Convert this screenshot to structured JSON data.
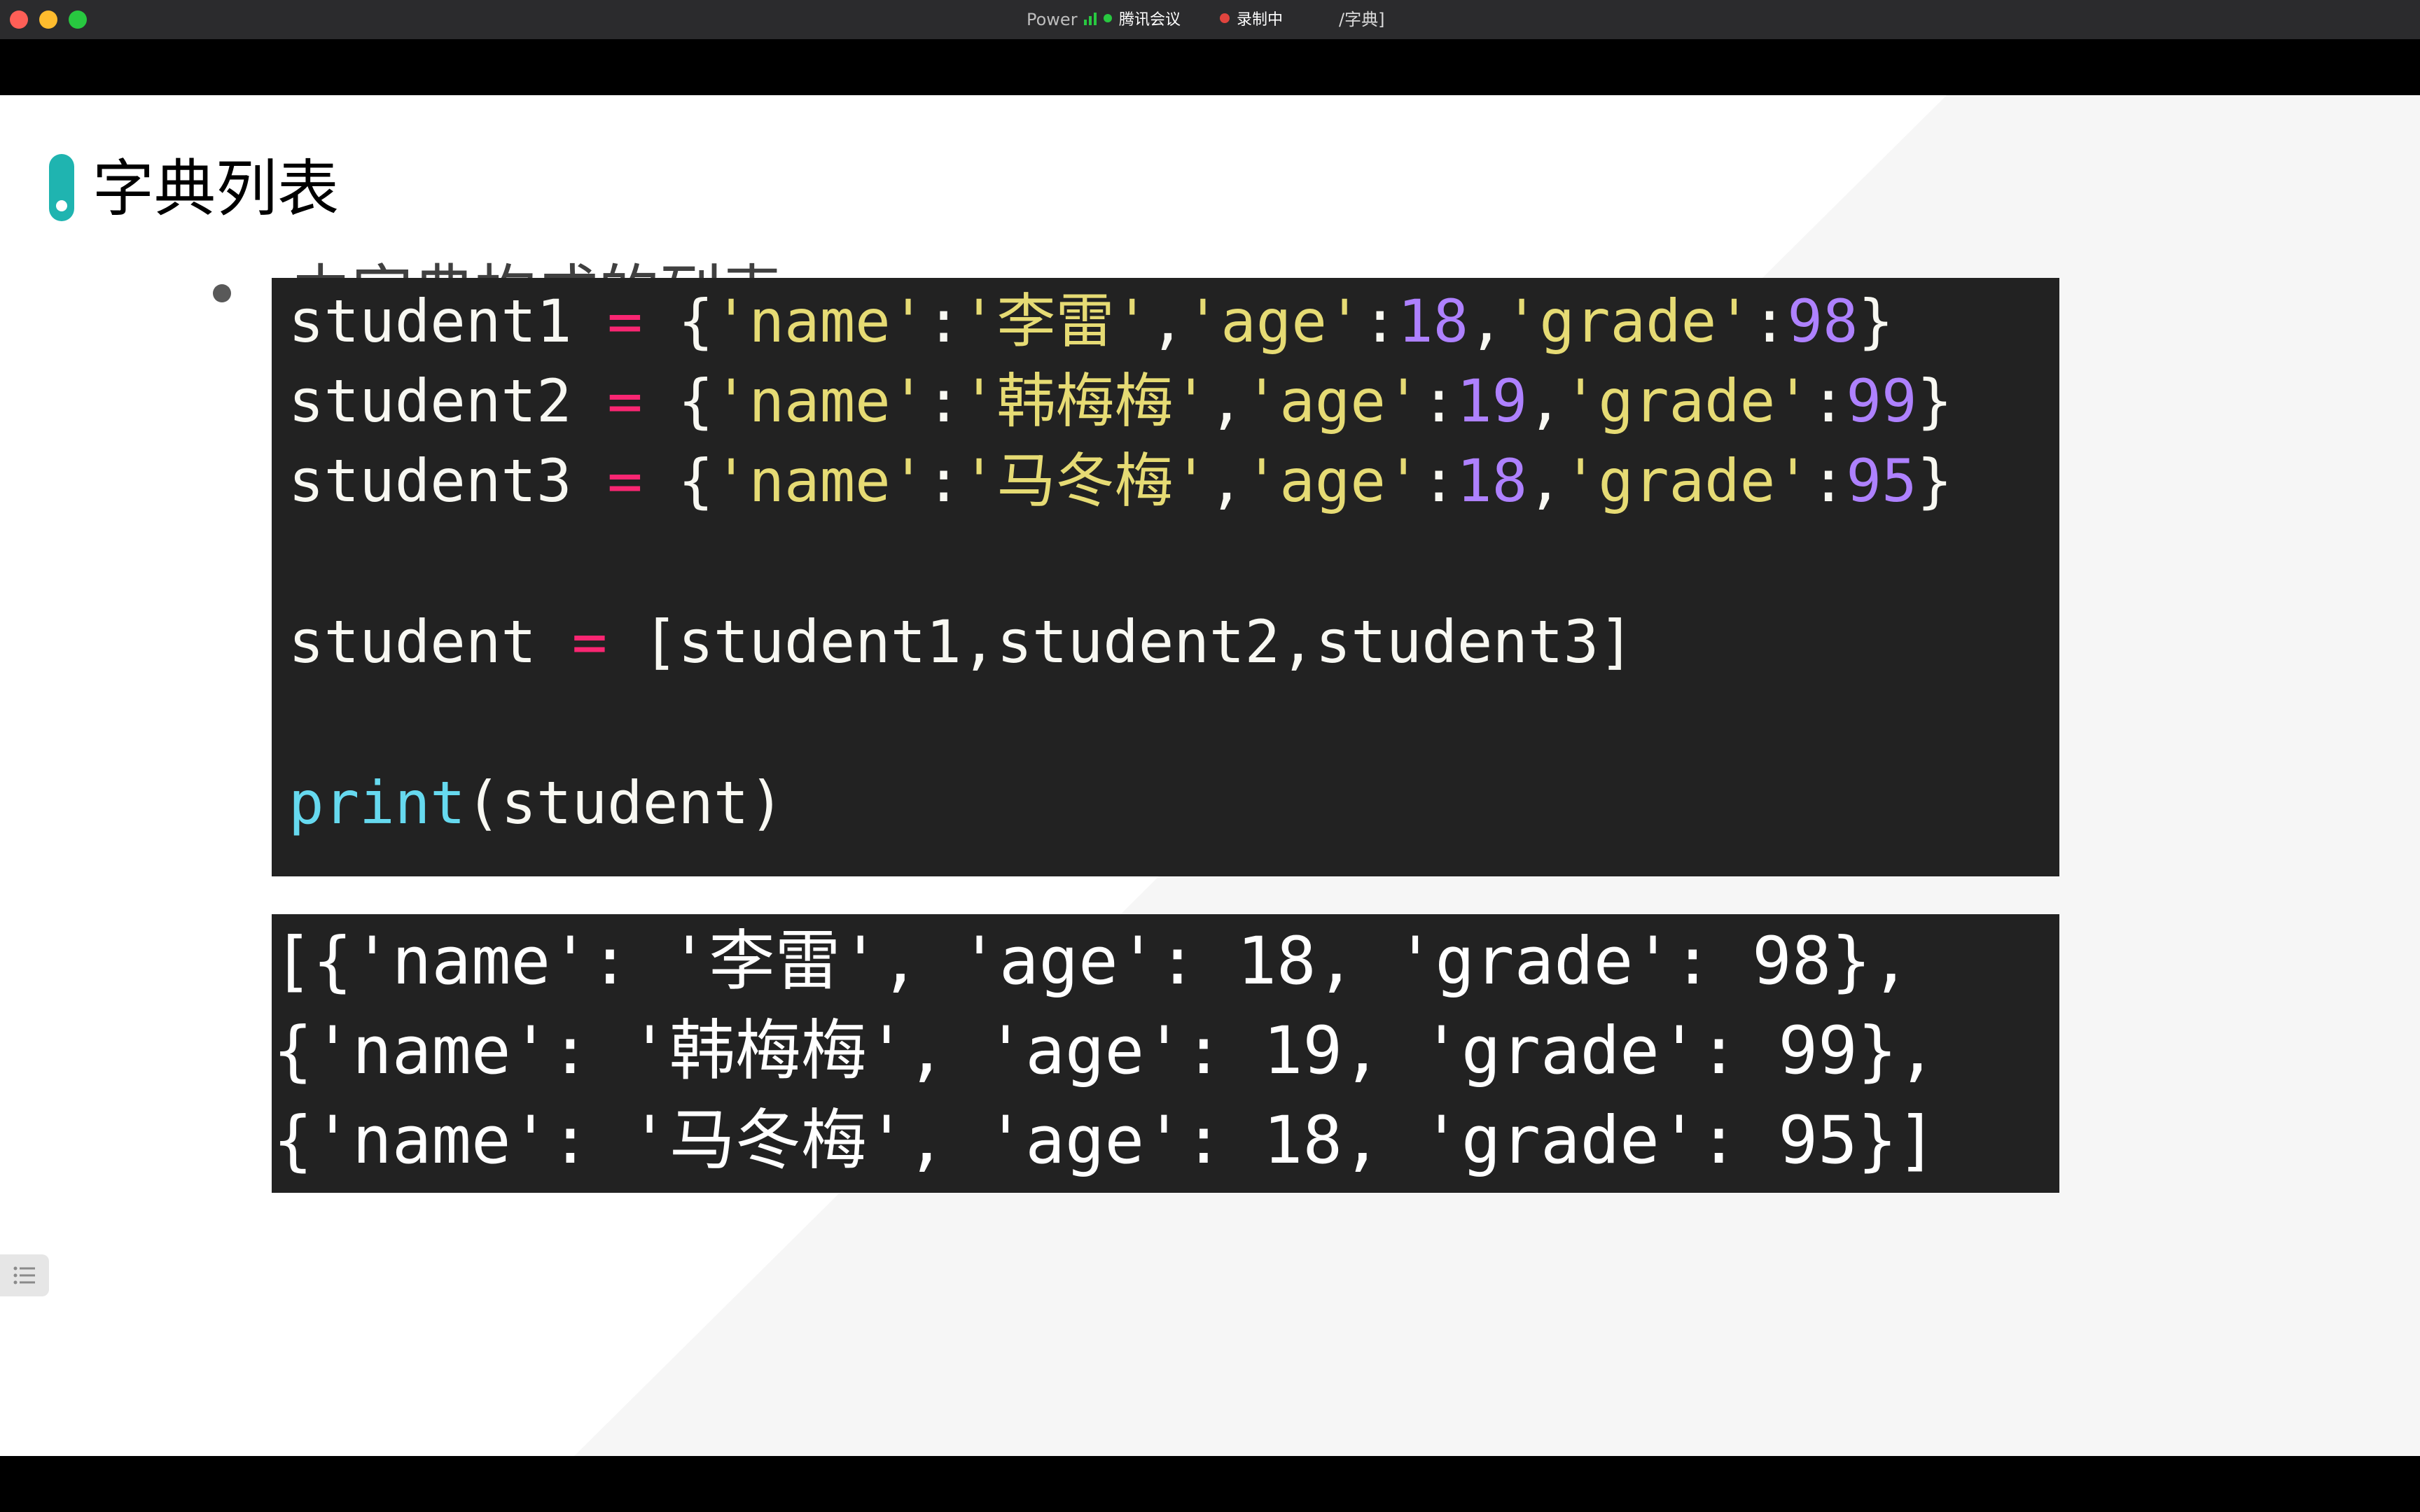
{
  "window": {
    "title": "Power",
    "meeting_app": "腾讯会议",
    "recording_label": "录制中",
    "document_name": "/字典]"
  },
  "slide": {
    "title": "字典列表",
    "bullet": "由字典构成的列表。",
    "accent_color": "#1fb4b0"
  },
  "code": {
    "line1": {
      "var": "student1",
      "op": "=",
      "p1": "{",
      "k1": "'name'",
      "c1": ":",
      "v1": "'李雷'",
      "s1": ",",
      "k2": "'age'",
      "c2": ":",
      "v2": "18",
      "s2": ",",
      "k3": "'grade'",
      "c3": ":",
      "v3": "98",
      "p2": "}"
    },
    "line2": {
      "var": "student2",
      "op": "=",
      "p1": "{",
      "k1": "'name'",
      "c1": ":",
      "v1": "'韩梅梅'",
      "s1": ",",
      "k2": "'age'",
      "c2": ":",
      "v2": "19",
      "s2": ",",
      "k3": "'grade'",
      "c3": ":",
      "v3": "99",
      "p2": "}"
    },
    "line3": {
      "var": "student3",
      "op": "=",
      "p1": "{",
      "k1": "'name'",
      "c1": ":",
      "v1": "'马冬梅'",
      "s1": ",",
      "k2": "'age'",
      "c2": ":",
      "v2": "18",
      "s2": ",",
      "k3": "'grade'",
      "c3": ":",
      "v3": "95",
      "p2": "}"
    },
    "line4": {
      "var": "student",
      "op": "=",
      "rest": "[student1,student2,student3]"
    },
    "line5": {
      "fn": "print",
      "rest": "(student)"
    }
  },
  "output": {
    "lines": [
      "[{'name': '李雷', 'age': 18, 'grade': 98},",
      "{'name': '韩梅梅', 'age': 19, 'grade': 99},",
      "{'name': '马冬梅', 'age': 18, 'grade': 95}]"
    ]
  },
  "icons": {
    "side_tab": "list-icon"
  }
}
